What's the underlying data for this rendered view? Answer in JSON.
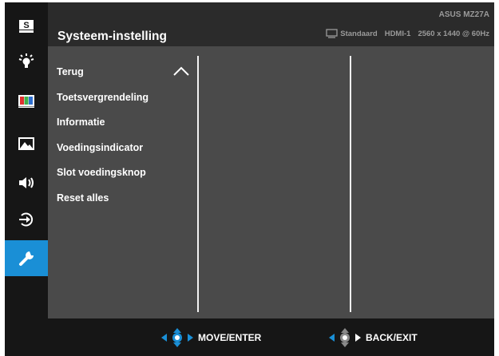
{
  "header": {
    "title": "Systeem-instelling",
    "model": "ASUS MZ27A",
    "mode": "Standaard",
    "input": "HDMI-1",
    "resolution": "2560 x 1440 @ 60Hz"
  },
  "sidebar": {
    "items": [
      {
        "name": "splendid",
        "label": "S",
        "icon": "splendid-icon"
      },
      {
        "name": "blue-light-filter",
        "icon": "blue-light-filter-icon"
      },
      {
        "name": "color",
        "icon": "color-bars-icon"
      },
      {
        "name": "image",
        "icon": "image-icon"
      },
      {
        "name": "sound",
        "icon": "speaker-icon"
      },
      {
        "name": "input-select",
        "icon": "input-select-icon"
      },
      {
        "name": "system-setup",
        "icon": "wrench-icon",
        "active": true
      }
    ]
  },
  "menu": {
    "items": [
      {
        "label": "Terug"
      },
      {
        "label": "Toetsvergrendeling"
      },
      {
        "label": "Informatie"
      },
      {
        "label": "Voedingsindicator"
      },
      {
        "label": "Slot voedingsknop"
      },
      {
        "label": "Reset alles"
      }
    ]
  },
  "footer": {
    "move_enter": "MOVE/ENTER",
    "back_exit": "BACK/EXIT"
  },
  "colors": {
    "accent": "#1a8fd6",
    "panel": "#4a4a4a",
    "rail": "#161616",
    "header": "#2b2b2b"
  }
}
